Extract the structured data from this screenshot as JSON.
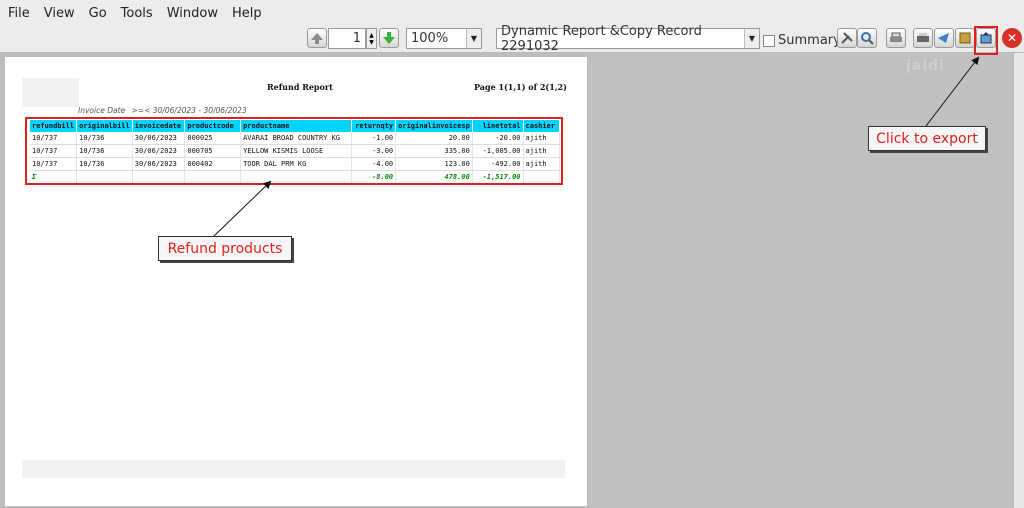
{
  "menu": {
    "file": "File",
    "view": "View",
    "go": "Go",
    "tools": "Tools",
    "window": "Window",
    "help": "Help"
  },
  "toolbar": {
    "page_number": "1",
    "zoom": "100%",
    "report_select": "Dynamic Report &Copy Record 2291032",
    "summary_label": "Summary"
  },
  "report": {
    "title": "Refund Report",
    "page_info": "Page 1(1,1) of 2(1,2)",
    "date_label": "Invoice Date",
    "date_range": ">=<  30/06/2023 - 30/06/2023",
    "columns": [
      "refundbill",
      "originalbill",
      "invoicedate",
      "productcode",
      "productname",
      "returnqty",
      "originalinvoicesp",
      "linetotal",
      "cashier"
    ],
    "rows": [
      [
        "10/737",
        "10/736",
        "30/06/2023",
        "000025",
        "AVARAI BROAD COUNTRY KG",
        "-1.00",
        "20.00",
        "-20.00",
        "ajith"
      ],
      [
        "10/737",
        "10/736",
        "30/06/2023",
        "000705",
        "YELLOW KISMIS LOOSE",
        "-3.00",
        "335.00",
        "-1,005.00",
        "ajith"
      ],
      [
        "10/737",
        "10/736",
        "30/06/2023",
        "000402",
        "TOOR DAL PRM  KG",
        "-4.00",
        "123.00",
        "-492.00",
        "ajith"
      ]
    ],
    "total": {
      "symbol": "Σ",
      "returnqty": "-8.00",
      "originalinvoicesp": "478.00",
      "linetotal": "-1,517.00"
    }
  },
  "annotations": {
    "refund_products": "Refund products",
    "click_to_export": "Click to export"
  },
  "watermark": "jaldi",
  "colors": {
    "header_cyan": "#00d5ff",
    "highlight_red": "#e02020",
    "total_green": "#0a8a0a"
  }
}
